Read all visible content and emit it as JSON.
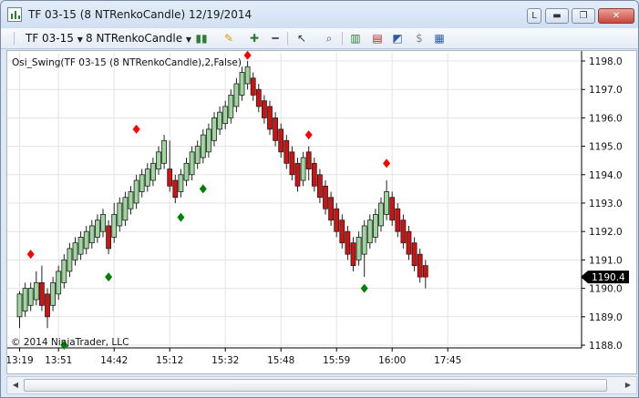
{
  "window": {
    "title": "TF 03-15 (8 NTRenkoCandle)  12/19/2014",
    "buttons": {
      "layout": "L",
      "minimize": "▬",
      "maximize": "❐",
      "close": "✕"
    }
  },
  "toolbar": {
    "instrument": "TF 03-15",
    "period": "8 NTRenkoCandle",
    "icons": [
      "bar-type-icon",
      "pencil-draw-icon",
      "zoom-in-icon",
      "zoom-out-icon",
      "cursor-icon",
      "magnifier-icon",
      "strategies-icon",
      "indicators-icon",
      "chart-properties-icon",
      "data-box-icon",
      "chart-trader-icon"
    ]
  },
  "colors": {
    "up_fill": "#9fd69f",
    "down_fill": "#d01212",
    "candle_outline": "#202020",
    "swing_high": "#ff0000",
    "swing_low": "#008000",
    "last_price_bg": "#000000",
    "grid": "#e3e3e3"
  },
  "chart_data": {
    "type": "candlestick",
    "indicator_label": "Osi_Swing(TF 03-15 (8 NTRenkoCandle),2,False)",
    "copyright": "© 2014 NinjaTrader, LLC",
    "y_range": [
      1188.0,
      1198.2
    ],
    "y_ticks": [
      "1198.0",
      "1197.0",
      "1196.0",
      "1195.0",
      "1194.0",
      "1193.0",
      "1192.0",
      "1191.0",
      "1190.0",
      "1189.0",
      "1188.0"
    ],
    "x_ticks": [
      {
        "label": "13:19",
        "bar": 0
      },
      {
        "label": "13:51",
        "bar": 7
      },
      {
        "label": "14:42",
        "bar": 17
      },
      {
        "label": "15:12",
        "bar": 27
      },
      {
        "label": "15:32",
        "bar": 37
      },
      {
        "label": "15:48",
        "bar": 47
      },
      {
        "label": "15:59",
        "bar": 57
      },
      {
        "label": "16:00",
        "bar": 67
      },
      {
        "label": "17:45",
        "bar": 77
      }
    ],
    "last_price": "1190.4",
    "grid": true,
    "bars": [
      {
        "o": 1189.0,
        "c": 1189.8,
        "h": 1189.9,
        "l": 1188.6
      },
      {
        "o": 1189.2,
        "c": 1190.0,
        "h": 1190.2,
        "l": 1189.0
      },
      {
        "o": 1189.4,
        "c": 1190.0,
        "h": 1190.2,
        "l": 1189.2
      },
      {
        "o": 1189.6,
        "c": 1190.2,
        "h": 1190.6,
        "l": 1189.4
      },
      {
        "o": 1190.2,
        "c": 1189.4,
        "h": 1190.8,
        "l": 1189.2
      },
      {
        "o": 1189.8,
        "c": 1189.0,
        "h": 1190.0,
        "l": 1188.6
      },
      {
        "o": 1189.4,
        "c": 1190.2,
        "h": 1190.4,
        "l": 1189.2
      },
      {
        "o": 1189.8,
        "c": 1190.6,
        "h": 1190.8,
        "l": 1189.6
      },
      {
        "o": 1190.2,
        "c": 1191.0,
        "h": 1191.2,
        "l": 1190.0
      },
      {
        "o": 1190.6,
        "c": 1191.4,
        "h": 1191.6,
        "l": 1190.4
      },
      {
        "o": 1191.0,
        "c": 1191.6,
        "h": 1191.8,
        "l": 1190.8
      },
      {
        "o": 1191.2,
        "c": 1191.8,
        "h": 1192.0,
        "l": 1191.0
      },
      {
        "o": 1191.4,
        "c": 1192.0,
        "h": 1192.2,
        "l": 1191.2
      },
      {
        "o": 1191.6,
        "c": 1192.2,
        "h": 1192.4,
        "l": 1191.4
      },
      {
        "o": 1191.8,
        "c": 1192.4,
        "h": 1192.6,
        "l": 1191.6
      },
      {
        "o": 1192.0,
        "c": 1192.6,
        "h": 1192.8,
        "l": 1191.8
      },
      {
        "o": 1192.2,
        "c": 1191.4,
        "h": 1192.4,
        "l": 1191.2
      },
      {
        "o": 1191.8,
        "c": 1192.6,
        "h": 1193.0,
        "l": 1191.6
      },
      {
        "o": 1192.2,
        "c": 1193.0,
        "h": 1193.2,
        "l": 1192.0
      },
      {
        "o": 1192.4,
        "c": 1193.2,
        "h": 1193.4,
        "l": 1192.2
      },
      {
        "o": 1192.8,
        "c": 1193.4,
        "h": 1193.6,
        "l": 1192.6
      },
      {
        "o": 1193.0,
        "c": 1193.8,
        "h": 1194.0,
        "l": 1192.8
      },
      {
        "o": 1193.4,
        "c": 1194.0,
        "h": 1194.2,
        "l": 1193.2
      },
      {
        "o": 1193.6,
        "c": 1194.2,
        "h": 1194.4,
        "l": 1193.4
      },
      {
        "o": 1193.8,
        "c": 1194.4,
        "h": 1194.6,
        "l": 1193.6
      },
      {
        "o": 1194.2,
        "c": 1194.8,
        "h": 1195.0,
        "l": 1194.0
      },
      {
        "o": 1194.4,
        "c": 1195.2,
        "h": 1195.4,
        "l": 1194.2
      },
      {
        "o": 1194.2,
        "c": 1193.6,
        "h": 1195.2,
        "l": 1193.4
      },
      {
        "o": 1193.8,
        "c": 1193.2,
        "h": 1194.0,
        "l": 1193.0
      },
      {
        "o": 1193.4,
        "c": 1194.0,
        "h": 1194.2,
        "l": 1193.2
      },
      {
        "o": 1193.8,
        "c": 1194.4,
        "h": 1194.6,
        "l": 1193.6
      },
      {
        "o": 1194.0,
        "c": 1194.8,
        "h": 1195.0,
        "l": 1193.8
      },
      {
        "o": 1194.4,
        "c": 1195.0,
        "h": 1195.2,
        "l": 1194.2
      },
      {
        "o": 1194.6,
        "c": 1195.4,
        "h": 1195.6,
        "l": 1194.4
      },
      {
        "o": 1194.8,
        "c": 1195.6,
        "h": 1195.8,
        "l": 1194.6
      },
      {
        "o": 1195.2,
        "c": 1196.0,
        "h": 1196.2,
        "l": 1195.0
      },
      {
        "o": 1195.6,
        "c": 1196.2,
        "h": 1196.4,
        "l": 1195.4
      },
      {
        "o": 1195.8,
        "c": 1196.4,
        "h": 1196.6,
        "l": 1195.6
      },
      {
        "o": 1196.0,
        "c": 1196.8,
        "h": 1197.0,
        "l": 1195.8
      },
      {
        "o": 1196.4,
        "c": 1197.2,
        "h": 1197.4,
        "l": 1196.2
      },
      {
        "o": 1196.8,
        "c": 1197.6,
        "h": 1197.8,
        "l": 1196.6
      },
      {
        "o": 1197.2,
        "c": 1197.8,
        "h": 1198.0,
        "l": 1197.0
      },
      {
        "o": 1197.4,
        "c": 1196.8,
        "h": 1197.6,
        "l": 1196.6
      },
      {
        "o": 1197.0,
        "c": 1196.4,
        "h": 1197.2,
        "l": 1196.2
      },
      {
        "o": 1196.6,
        "c": 1196.0,
        "h": 1196.8,
        "l": 1195.8
      },
      {
        "o": 1196.4,
        "c": 1195.6,
        "h": 1196.6,
        "l": 1195.4
      },
      {
        "o": 1196.0,
        "c": 1195.2,
        "h": 1196.2,
        "l": 1195.0
      },
      {
        "o": 1195.6,
        "c": 1194.8,
        "h": 1195.8,
        "l": 1194.6
      },
      {
        "o": 1195.2,
        "c": 1194.4,
        "h": 1195.4,
        "l": 1194.2
      },
      {
        "o": 1194.8,
        "c": 1194.0,
        "h": 1195.0,
        "l": 1193.8
      },
      {
        "o": 1194.4,
        "c": 1193.6,
        "h": 1194.6,
        "l": 1193.4
      },
      {
        "o": 1193.8,
        "c": 1194.6,
        "h": 1194.8,
        "l": 1193.6
      },
      {
        "o": 1194.8,
        "c": 1194.2,
        "h": 1195.0,
        "l": 1193.8
      },
      {
        "o": 1194.4,
        "c": 1193.6,
        "h": 1194.6,
        "l": 1193.4
      },
      {
        "o": 1194.0,
        "c": 1193.2,
        "h": 1194.2,
        "l": 1193.0
      },
      {
        "o": 1193.6,
        "c": 1192.8,
        "h": 1193.8,
        "l": 1192.6
      },
      {
        "o": 1193.2,
        "c": 1192.4,
        "h": 1193.4,
        "l": 1192.2
      },
      {
        "o": 1192.8,
        "c": 1192.0,
        "h": 1193.0,
        "l": 1191.8
      },
      {
        "o": 1192.4,
        "c": 1191.6,
        "h": 1192.6,
        "l": 1191.4
      },
      {
        "o": 1192.0,
        "c": 1191.2,
        "h": 1192.2,
        "l": 1191.0
      },
      {
        "o": 1191.6,
        "c": 1190.8,
        "h": 1191.8,
        "l": 1190.6
      },
      {
        "o": 1191.0,
        "c": 1191.8,
        "h": 1192.0,
        "l": 1190.8
      },
      {
        "o": 1191.2,
        "c": 1192.2,
        "h": 1192.4,
        "l": 1190.4
      },
      {
        "o": 1191.6,
        "c": 1192.4,
        "h": 1192.6,
        "l": 1191.4
      },
      {
        "o": 1191.8,
        "c": 1192.6,
        "h": 1192.8,
        "l": 1191.6
      },
      {
        "o": 1192.2,
        "c": 1193.0,
        "h": 1193.2,
        "l": 1192.0
      },
      {
        "o": 1192.6,
        "c": 1193.4,
        "h": 1193.8,
        "l": 1192.4
      },
      {
        "o": 1193.2,
        "c": 1192.4,
        "h": 1193.4,
        "l": 1192.2
      },
      {
        "o": 1192.8,
        "c": 1192.0,
        "h": 1193.0,
        "l": 1191.8
      },
      {
        "o": 1192.4,
        "c": 1191.6,
        "h": 1192.6,
        "l": 1191.4
      },
      {
        "o": 1192.0,
        "c": 1191.2,
        "h": 1192.2,
        "l": 1191.0
      },
      {
        "o": 1191.6,
        "c": 1190.8,
        "h": 1191.8,
        "l": 1190.6
      },
      {
        "o": 1191.2,
        "c": 1190.4,
        "h": 1191.4,
        "l": 1190.2
      },
      {
        "o": 1190.8,
        "c": 1190.4,
        "h": 1191.0,
        "l": 1190.0
      }
    ],
    "swing_highs": [
      {
        "bar": 2,
        "price": 1191.2
      },
      {
        "bar": 21,
        "price": 1195.6
      },
      {
        "bar": 41,
        "price": 1198.2
      },
      {
        "bar": 52,
        "price": 1195.4
      },
      {
        "bar": 66,
        "price": 1194.4
      }
    ],
    "swing_lows": [
      {
        "bar": 8,
        "price": 1188.0
      },
      {
        "bar": 16,
        "price": 1190.4
      },
      {
        "bar": 29,
        "price": 1192.5
      },
      {
        "bar": 33,
        "price": 1193.5
      },
      {
        "bar": 62,
        "price": 1190.0
      }
    ]
  }
}
